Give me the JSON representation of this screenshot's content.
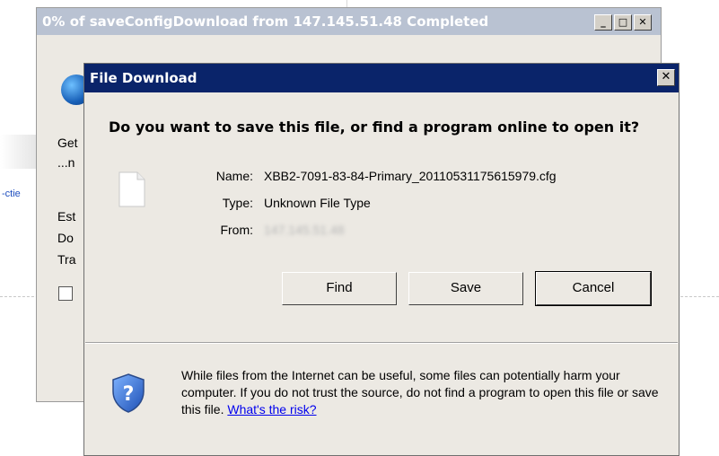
{
  "back_window": {
    "title": "0% of saveConfigDownload from 147.145.51.48 Completed",
    "buttons": {
      "minimize": "_",
      "maximize": "□",
      "close": "✕"
    },
    "text_fragments": [
      "Get",
      "...n",
      "Est",
      "Do",
      "Tra"
    ]
  },
  "background": {
    "link_fragment": "-ctie"
  },
  "dialog": {
    "title": "File Download",
    "close_label": "✕",
    "question": "Do you want to save this file, or find a program online to open it?",
    "fields": {
      "name_label": "Name:",
      "name_value": "XBB2-7091-83-84-Primary_20110531175615979.cfg",
      "type_label": "Type:",
      "type_value": "Unknown File Type",
      "from_label": "From:",
      "from_value": "147.145.51.48"
    },
    "buttons": {
      "find": "Find",
      "save": "Save",
      "cancel": "Cancel"
    },
    "warning_text": "While files from the Internet can be useful, some files can potentially harm your computer. If you do not trust the source, do not find a program to open this file or save this file. ",
    "risk_link": "What's the risk?"
  },
  "icons": {
    "file": "file-icon",
    "shield": "shield-question-icon",
    "globe": "globe-icon"
  },
  "colors": {
    "dialog_title_bar": "#0a246a",
    "inactive_title_bar": "#b9c2d2",
    "dialog_bg": "#ece9e3",
    "link": "#0000ee"
  }
}
